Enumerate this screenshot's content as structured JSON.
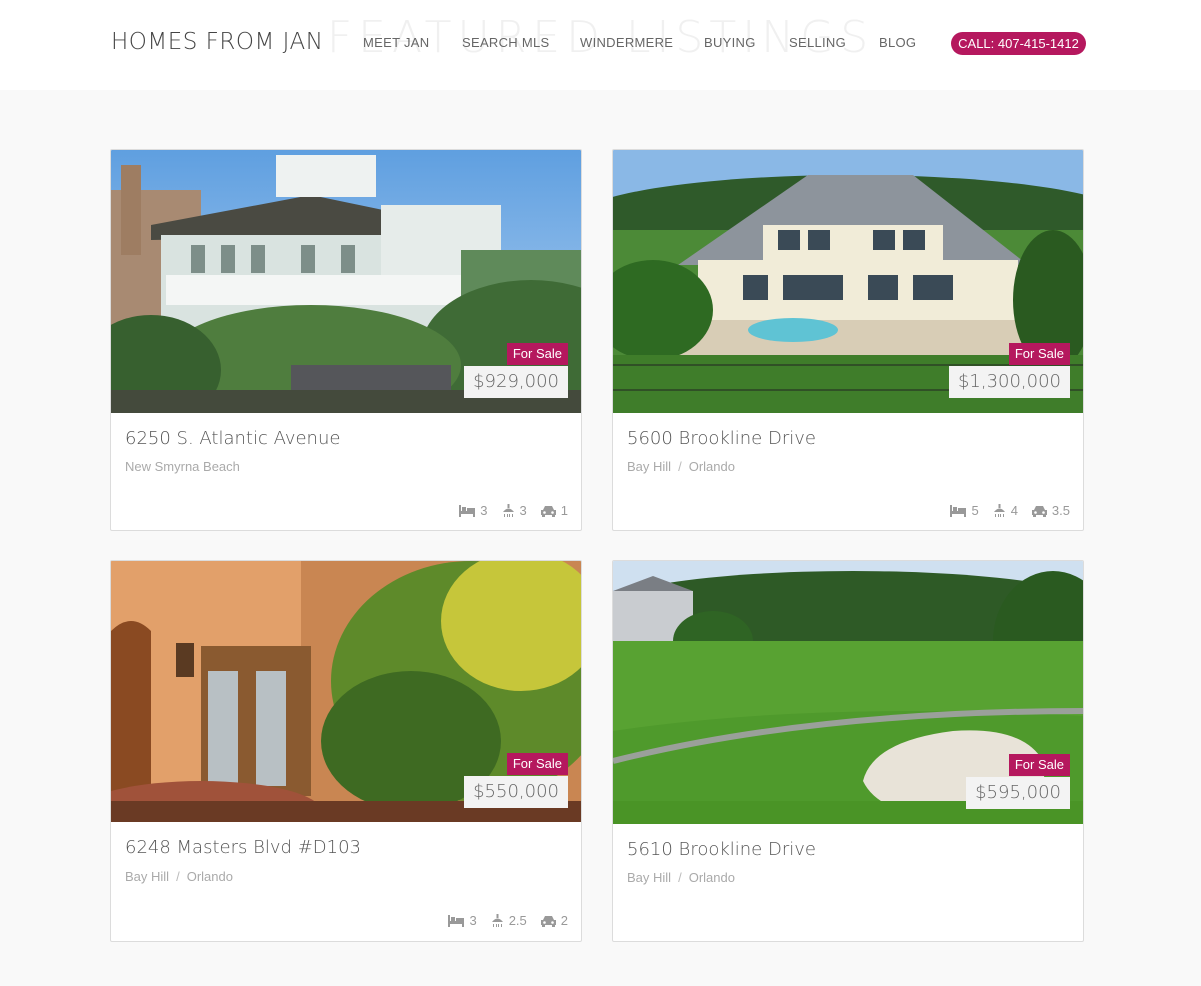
{
  "header": {
    "logo": "HOMES FROM JAN",
    "section_heading": "FEATURED LISTINGS",
    "nav": [
      "MEET JAN",
      "SEARCH MLS",
      "WINDERMERE",
      "BUYING",
      "SELLING",
      "BLOG"
    ],
    "cta": "CALL: 407-415-1412"
  },
  "colors": {
    "accent": "#b5185e",
    "background": "#f9f9f9"
  },
  "listings": [
    {
      "status": "For Sale",
      "price": "$929,000",
      "address": "6250 S. Atlantic Avenue",
      "locale": [
        "New Smyrna Beach"
      ],
      "beds": "3",
      "baths": "3",
      "garage": "1"
    },
    {
      "status": "For Sale",
      "price": "$1,300,000",
      "address": "5600 Brookline Drive",
      "locale": [
        "Bay Hill",
        "Orlando"
      ],
      "beds": "5",
      "baths": "4",
      "garage": "3.5"
    },
    {
      "status": "For Sale",
      "price": "$550,000",
      "address": "6248 Masters Blvd #D103",
      "locale": [
        "Bay Hill",
        "Orlando"
      ],
      "beds": "3",
      "baths": "2.5",
      "garage": "2"
    },
    {
      "status": "For Sale",
      "price": "$595,000",
      "address": "5610 Brookline Drive",
      "locale": [
        "Bay Hill",
        "Orlando"
      ]
    }
  ],
  "icons": {
    "beds": "bed-icon",
    "baths": "shower-icon",
    "garage": "car-icon"
  }
}
